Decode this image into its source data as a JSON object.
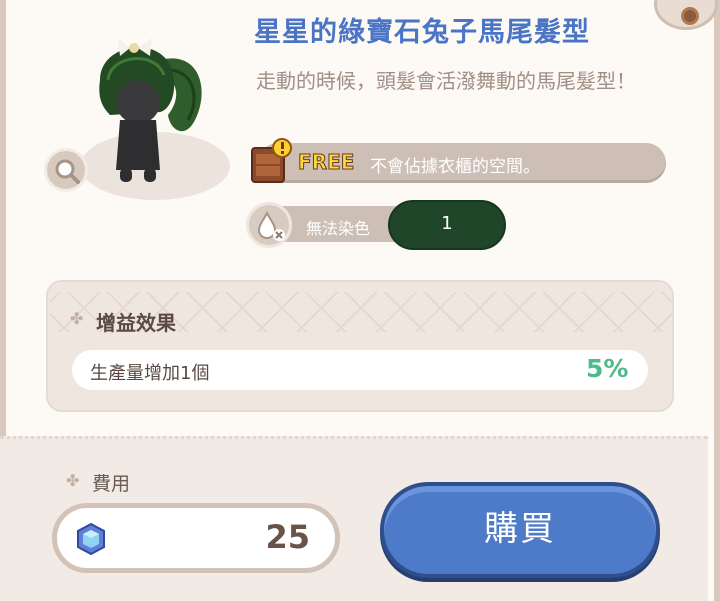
{
  "item": {
    "title": "星星的綠寶石兔子馬尾髮型",
    "description": "走動的時候，頭髮會活潑舞動的馬尾髮型！",
    "wardrobe_badge": "FREE",
    "wardrobe_text": "不會佔據衣櫃的空間。",
    "dye_label": "無法染色",
    "owned_count": "1"
  },
  "buff": {
    "title": "增益效果",
    "effect_label": "生產量增加1個",
    "effect_value": "5%"
  },
  "cost": {
    "label": "費用",
    "amount": "25",
    "currency_icon": "crystal-gem-icon"
  },
  "buy_button_label": "購買",
  "colors": {
    "title_blue": "#4a74c6",
    "buff_green": "#4dbb8a",
    "buy_button": "#4e7bc9",
    "count_pill": "#1f4629"
  }
}
